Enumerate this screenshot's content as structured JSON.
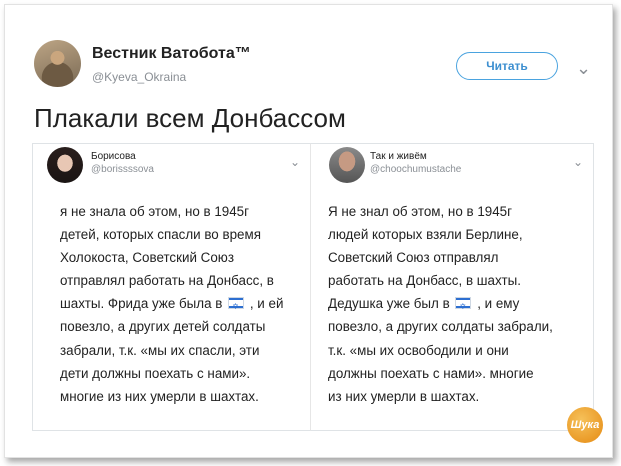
{
  "main_tweet": {
    "author_name": "Вестник Ватобота™",
    "author_handle": "@Kyeva_Okraina",
    "follow_label": "Читать",
    "text": "Плакали всем Донбассом"
  },
  "left_card": {
    "author_name": "Борисова",
    "author_handle": "@borissssova",
    "lines": [
      "я не знала об этом, но в 1945г",
      "детей, которых спасли во время",
      "Холокоста, Советский Союз",
      "отправлял работать на Донбасс, в",
      "шахты. Фрида уже была в",
      ", и ей",
      "повезло, а других детей солдаты",
      "забрали, т.к. «мы их спасли, эти",
      "дети должны поехать с нами».",
      "многие из них умерли в шахтах."
    ]
  },
  "right_card": {
    "author_name": "Так и живём",
    "author_handle": "@choochumustache",
    "lines": [
      "Я не знал об этом, но в 1945г",
      "людей которых взяли Берлине,",
      "Советский Союз отправлял",
      "работать на Донбасс, в шахты.",
      "Дедушка уже был в",
      ", и ему",
      "повезло, а других солдаты забрали,",
      "т.к. «мы их освободили и они",
      "должны поехать с нами». многие",
      "из них умерли в шахтах."
    ]
  },
  "watermark": {
    "text": "Шука"
  },
  "icons": {
    "chevron": "chevron-down-icon",
    "flag": "israel-flag-icon"
  }
}
